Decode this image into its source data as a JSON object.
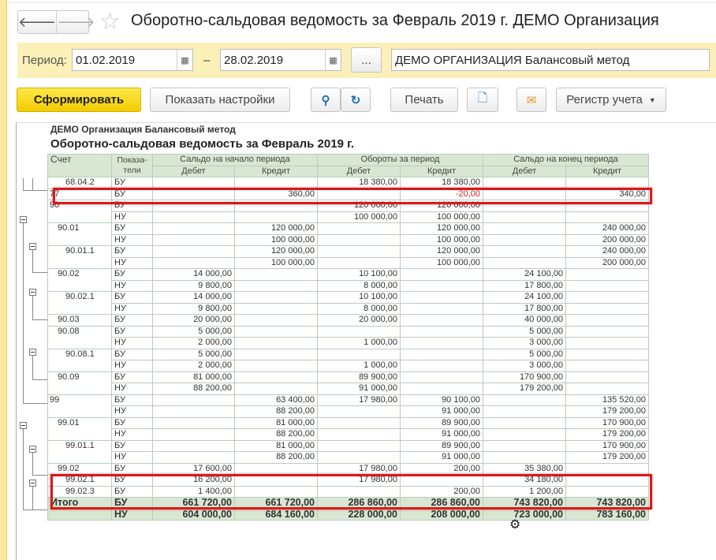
{
  "window": {
    "title": "Оборотно-сальдовая ведомость за Февраль 2019 г. ДЕМО Организация"
  },
  "filter": {
    "period_label": "Период:",
    "date_from": "01.02.2019",
    "date_to": "28.02.2019",
    "dash": "–",
    "more": "...",
    "organization": "ДЕМО ОРГАНИЗАЦИЯ Балансовый метод"
  },
  "toolbar": {
    "generate": "Сформировать",
    "show_settings": "Показать настройки",
    "print": "Печать",
    "register": "Регистр учета"
  },
  "report": {
    "org": "ДЕМО Организация Балансовый метод",
    "title": "Оборотно-сальдовая ведомость за Февраль 2019 г.",
    "headers": {
      "account": "Счет",
      "indicators": "Показа-\nтели",
      "start": "Сальдо на начало периода",
      "turnover": "Обороты за период",
      "end": "Сальдо на конец периода",
      "debit": "Дебет",
      "credit": "Кредит"
    },
    "rows": [
      {
        "acct": "68.04.2",
        "level": 2,
        "ind": [
          [
            "БУ",
            "",
            "",
            "18 380,00",
            "18 380,00",
            "",
            ""
          ]
        ]
      },
      {
        "acct": "77",
        "level": 0,
        "ind": [
          [
            "БУ",
            "",
            "360,00",
            "",
            "-20,00",
            "",
            "340,00"
          ]
        ]
      },
      {
        "acct": "90",
        "level": 0,
        "ind": [
          [
            "БУ",
            "",
            "",
            "120 000,00",
            "120 000,00",
            "",
            ""
          ],
          [
            "НУ",
            "",
            "",
            "100 000,00",
            "100 000,00",
            "",
            ""
          ]
        ]
      },
      {
        "acct": "90.01",
        "level": 1,
        "ind": [
          [
            "БУ",
            "",
            "120 000,00",
            "",
            "120 000,00",
            "",
            "240 000,00"
          ],
          [
            "НУ",
            "",
            "100 000,00",
            "",
            "100 000,00",
            "",
            "200 000,00"
          ]
        ]
      },
      {
        "acct": "90.01.1",
        "level": 2,
        "ind": [
          [
            "БУ",
            "",
            "120 000,00",
            "",
            "120 000,00",
            "",
            "240 000,00"
          ],
          [
            "НУ",
            "",
            "100 000,00",
            "",
            "100 000,00",
            "",
            "200 000,00"
          ]
        ]
      },
      {
        "acct": "90.02",
        "level": 1,
        "ind": [
          [
            "БУ",
            "14 000,00",
            "",
            "10 100,00",
            "",
            "24 100,00",
            ""
          ],
          [
            "НУ",
            "9 800,00",
            "",
            "8 000,00",
            "",
            "17 800,00",
            ""
          ]
        ]
      },
      {
        "acct": "90.02.1",
        "level": 2,
        "ind": [
          [
            "БУ",
            "14 000,00",
            "",
            "10 100,00",
            "",
            "24 100,00",
            ""
          ],
          [
            "НУ",
            "9 800,00",
            "",
            "8 000,00",
            "",
            "17 800,00",
            ""
          ]
        ]
      },
      {
        "acct": "90.03",
        "level": 1,
        "ind": [
          [
            "БУ",
            "20 000,00",
            "",
            "20 000,00",
            "",
            "40 000,00",
            ""
          ]
        ]
      },
      {
        "acct": "90.08",
        "level": 1,
        "ind": [
          [
            "БУ",
            "5 000,00",
            "",
            "",
            "",
            "5 000,00",
            ""
          ],
          [
            "НУ",
            "2 000,00",
            "",
            "1 000,00",
            "",
            "3 000,00",
            ""
          ]
        ]
      },
      {
        "acct": "90.08.1",
        "level": 2,
        "ind": [
          [
            "БУ",
            "5 000,00",
            "",
            "",
            "",
            "5 000,00",
            ""
          ],
          [
            "НУ",
            "2 000,00",
            "",
            "1 000,00",
            "",
            "3 000,00",
            ""
          ]
        ]
      },
      {
        "acct": "90.09",
        "level": 1,
        "ind": [
          [
            "БУ",
            "81 000,00",
            "",
            "89 900,00",
            "",
            "170 900,00",
            ""
          ],
          [
            "НУ",
            "88 200,00",
            "",
            "91 000,00",
            "",
            "179 200,00",
            ""
          ]
        ]
      },
      {
        "acct": "99",
        "level": 0,
        "ind": [
          [
            "БУ",
            "",
            "63 400,00",
            "17 980,00",
            "90 100,00",
            "",
            "135 520,00"
          ],
          [
            "НУ",
            "",
            "88 200,00",
            "",
            "91 000,00",
            "",
            "179 200,00"
          ]
        ]
      },
      {
        "acct": "99.01",
        "level": 1,
        "ind": [
          [
            "БУ",
            "",
            "81 000,00",
            "",
            "89 900,00",
            "",
            "170 900,00"
          ],
          [
            "НУ",
            "",
            "88 200,00",
            "",
            "91 000,00",
            "",
            "179 200,00"
          ]
        ]
      },
      {
        "acct": "99.01.1",
        "level": 2,
        "ind": [
          [
            "БУ",
            "",
            "81 000,00",
            "",
            "89 900,00",
            "",
            "170 900,00"
          ],
          [
            "НУ",
            "",
            "88 200,00",
            "",
            "91 000,00",
            "",
            "179 200,00"
          ]
        ]
      },
      {
        "acct": "99.02",
        "level": 1,
        "ind": [
          [
            "БУ",
            "17 600,00",
            "",
            "17 980,00",
            "200,00",
            "35 380,00",
            ""
          ]
        ]
      },
      {
        "acct": "99.02.1",
        "level": 2,
        "ind": [
          [
            "БУ",
            "16 200,00",
            "",
            "17 980,00",
            "",
            "34 180,00",
            ""
          ]
        ]
      },
      {
        "acct": "99.02.3",
        "level": 2,
        "ind": [
          [
            "БУ",
            "1 400,00",
            "",
            "",
            "200,00",
            "1 200,00",
            ""
          ]
        ]
      }
    ],
    "total": {
      "label": "Итого",
      "ind": [
        [
          "БУ",
          "661 720,00",
          "661 720,00",
          "286 860,00",
          "286 860,00",
          "743 820,00",
          "743 820,00"
        ],
        [
          "НУ",
          "604 000,00",
          "684 160,00",
          "228 000,00",
          "208 000,00",
          "723 000,00",
          "783 160,00"
        ]
      ]
    }
  },
  "colors": {
    "highlight": "#d9191c",
    "header_bg": "#d9e7d2",
    "primary_button": "#f5d31a",
    "filter_bg": "#fbf0b8",
    "negative": "#e02020"
  }
}
